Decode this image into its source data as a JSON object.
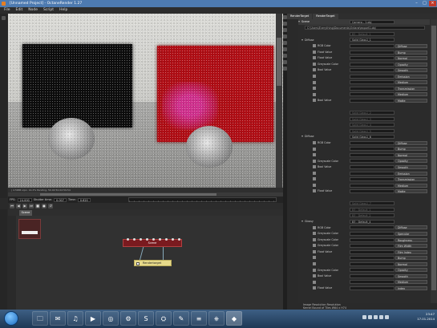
{
  "window": {
    "title": "[Unnamed Project] - OctaneRender 1.27"
  },
  "menu": [
    "File",
    "Edit",
    "Node",
    "Script",
    "Help"
  ],
  "viewport": {
    "status": "| 4.5686 s/px, 14.2% Pending, 50.02:50.02:59.54"
  },
  "fps_bar": {
    "fps_label": "FPS:",
    "fps_value": "24.000",
    "shutter_label": "Shutter time:",
    "shutter_value": "0.007",
    "time_label": "Time:",
    "time_value": "0.620"
  },
  "transport": [
    "⏮",
    "◀",
    "▶",
    "⏭",
    "■",
    "●",
    "↺"
  ],
  "node_editor": {
    "tab": "Scene",
    "scene_node_label": "Scene",
    "rendertarget_node_label": "Rendertarget"
  },
  "right_tabs": [
    "RenderTarget",
    "RenderTarget"
  ],
  "inspector_rows": [
    {
      "label": "Scene",
      "value": "Camera - 1.obj",
      "kind": "header"
    },
    {
      "label": "",
      "value": "C:\\Users\\Everything\\Documents\\Octane\\export1.obj",
      "kind": "path"
    },
    {
      "label": "",
      "value": "B3 - Default_1",
      "kind": "plain"
    },
    {
      "label": "Diffuse",
      "value": "Solid Glass1_1",
      "kind": "sub"
    },
    {
      "label": "RGB Color",
      "dd": "Diffuse",
      "kind": "prop"
    },
    {
      "label": "Float Value",
      "dd": "Bump",
      "kind": "prop"
    },
    {
      "label": "Float Value",
      "dd": "Normal",
      "kind": "prop"
    },
    {
      "label": "Greyscale Color",
      "dd": "Opacity",
      "kind": "prop"
    },
    {
      "label": "Bool Value",
      "dd": "Smooth",
      "kind": "prop"
    },
    {
      "label": "",
      "dd": "Emission",
      "kind": "prop"
    },
    {
      "label": "",
      "dd": "Medium",
      "kind": "prop"
    },
    {
      "label": "",
      "dd": "Transmission",
      "kind": "prop"
    },
    {
      "label": "",
      "dd": "Medium",
      "kind": "prop"
    },
    {
      "label": "Bool Value",
      "dd": "Matte",
      "kind": "prop"
    },
    {
      "label": "",
      "value": "",
      "kind": "blank"
    },
    {
      "label": "",
      "value": "Solid Glass1_2",
      "kind": "plain"
    },
    {
      "label": "",
      "value": "Solid Glass1_3",
      "kind": "plain"
    },
    {
      "label": "",
      "value": "Solid Glass1_4",
      "kind": "plain"
    },
    {
      "label": "",
      "value": "Solid Glass1_5",
      "kind": "plain"
    },
    {
      "label": "Diffuse",
      "value": "Solid Glass1_6",
      "kind": "sub"
    },
    {
      "label": "RGB Color",
      "dd": "Diffuse",
      "kind": "prop"
    },
    {
      "label": "",
      "dd": "Bump",
      "kind": "prop"
    },
    {
      "label": "",
      "dd": "Normal",
      "kind": "prop"
    },
    {
      "label": "Greyscale Color",
      "dd": "Opacity",
      "kind": "prop"
    },
    {
      "label": "Bool Value",
      "dd": "Smooth",
      "kind": "prop"
    },
    {
      "label": "",
      "dd": "Emission",
      "kind": "prop"
    },
    {
      "label": "",
      "dd": "Transmission",
      "kind": "prop"
    },
    {
      "label": "",
      "dd": "Medium",
      "kind": "prop"
    },
    {
      "label": "Float Value",
      "dd": "Matte",
      "kind": "prop"
    },
    {
      "label": "",
      "value": "",
      "kind": "blank"
    },
    {
      "label": "",
      "value": "Solid Glass1_7",
      "kind": "plain"
    },
    {
      "label": "",
      "value": "B3 - Default_1",
      "kind": "plain"
    },
    {
      "label": "",
      "value": "B3 - Default_2",
      "kind": "plain"
    },
    {
      "label": "Glossy",
      "value": "B3 - Default_4",
      "kind": "sub"
    },
    {
      "label": "RGB Color",
      "dd": "Diffuse",
      "kind": "prop"
    },
    {
      "label": "Greyscale Color",
      "dd": "Specular",
      "kind": "prop"
    },
    {
      "label": "Greyscale Color",
      "dd": "Roughness",
      "kind": "prop"
    },
    {
      "label": "Greyscale Color",
      "dd": "Film Width",
      "kind": "prop"
    },
    {
      "label": "Float Value",
      "dd": "Film Index",
      "kind": "prop"
    },
    {
      "label": "",
      "dd": "Bump",
      "kind": "prop"
    },
    {
      "label": "",
      "dd": "Normal",
      "kind": "prop"
    },
    {
      "label": "Greyscale Color",
      "dd": "Opacity",
      "kind": "prop"
    },
    {
      "label": "Bool Value",
      "dd": "Smooth",
      "kind": "prop"
    },
    {
      "label": "",
      "dd": "Medium",
      "kind": "prop"
    },
    {
      "label": "Float Value",
      "dd": "Index",
      "kind": "prop"
    },
    {
      "label": "",
      "value": "",
      "kind": "blank"
    }
  ],
  "inspector_footer": {
    "line1": "Image Resolution   Resolution",
    "line2": "Kernel   Bound of Tiles   W64 x H74"
  },
  "tray": {
    "account": "Standalone account",
    "status": "status",
    "updates": "updates",
    "time": "23:47",
    "date": "17.01.2014"
  },
  "taskbar_icons": [
    "🗀",
    "✉",
    "♫",
    "▶",
    "◎",
    "⚙",
    "S",
    "⛭",
    "✎",
    "≡",
    "⎈",
    "◆"
  ]
}
